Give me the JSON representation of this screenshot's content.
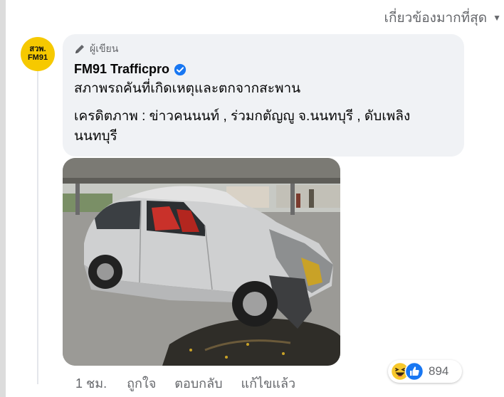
{
  "header": {
    "sort_label": "เกี่ยวข้องมากที่สุด"
  },
  "comment": {
    "avatar_text_line1": "สวพ.",
    "avatar_text_line2": "FM91",
    "role_label": "ผู้เขียน",
    "author_name": "FM91 Trafficpro",
    "text_line1": "สภาพรถคันที่เกิดเหตุและตกจากสะพาน",
    "text_line2": "เครดิตภาพ : ข่าวคนนนท์ , ร่วมกตัญญู จ.นนทบุรี , ดับเพลิงนนทบุรี",
    "time": "1 ชม.",
    "like_label": "ถูกใจ",
    "reply_label": "ตอบกลับ",
    "edited_label": "แก้ไขแล้ว",
    "reaction_count": "894",
    "reactions": [
      "haha-icon",
      "like-icon"
    ],
    "colors": {
      "bubble": "#f0f2f5",
      "verified": "#1877f2",
      "avatar": "#f6c900"
    }
  }
}
